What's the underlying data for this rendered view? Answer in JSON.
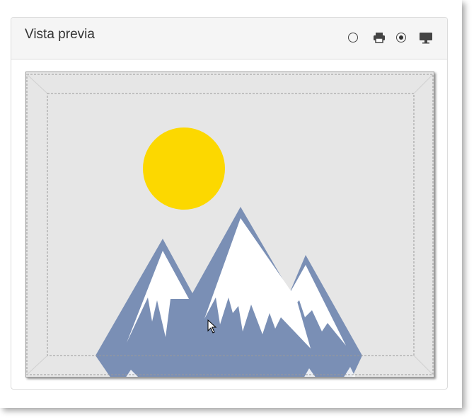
{
  "panel": {
    "title": "Vista previa"
  },
  "toolbar": {
    "items": [
      {
        "name": "radio-print",
        "state": "unchecked"
      },
      {
        "name": "printer-icon"
      },
      {
        "name": "radio-screen",
        "state": "checked"
      },
      {
        "name": "monitor-icon"
      }
    ]
  },
  "preview": {
    "image": "mountains-and-sun",
    "colors": {
      "background": "#e6e6e6",
      "sun": "#fcd800",
      "mountain": "#7a8fb5",
      "snow": "#ffffff",
      "margin_guides": "#999999"
    }
  }
}
